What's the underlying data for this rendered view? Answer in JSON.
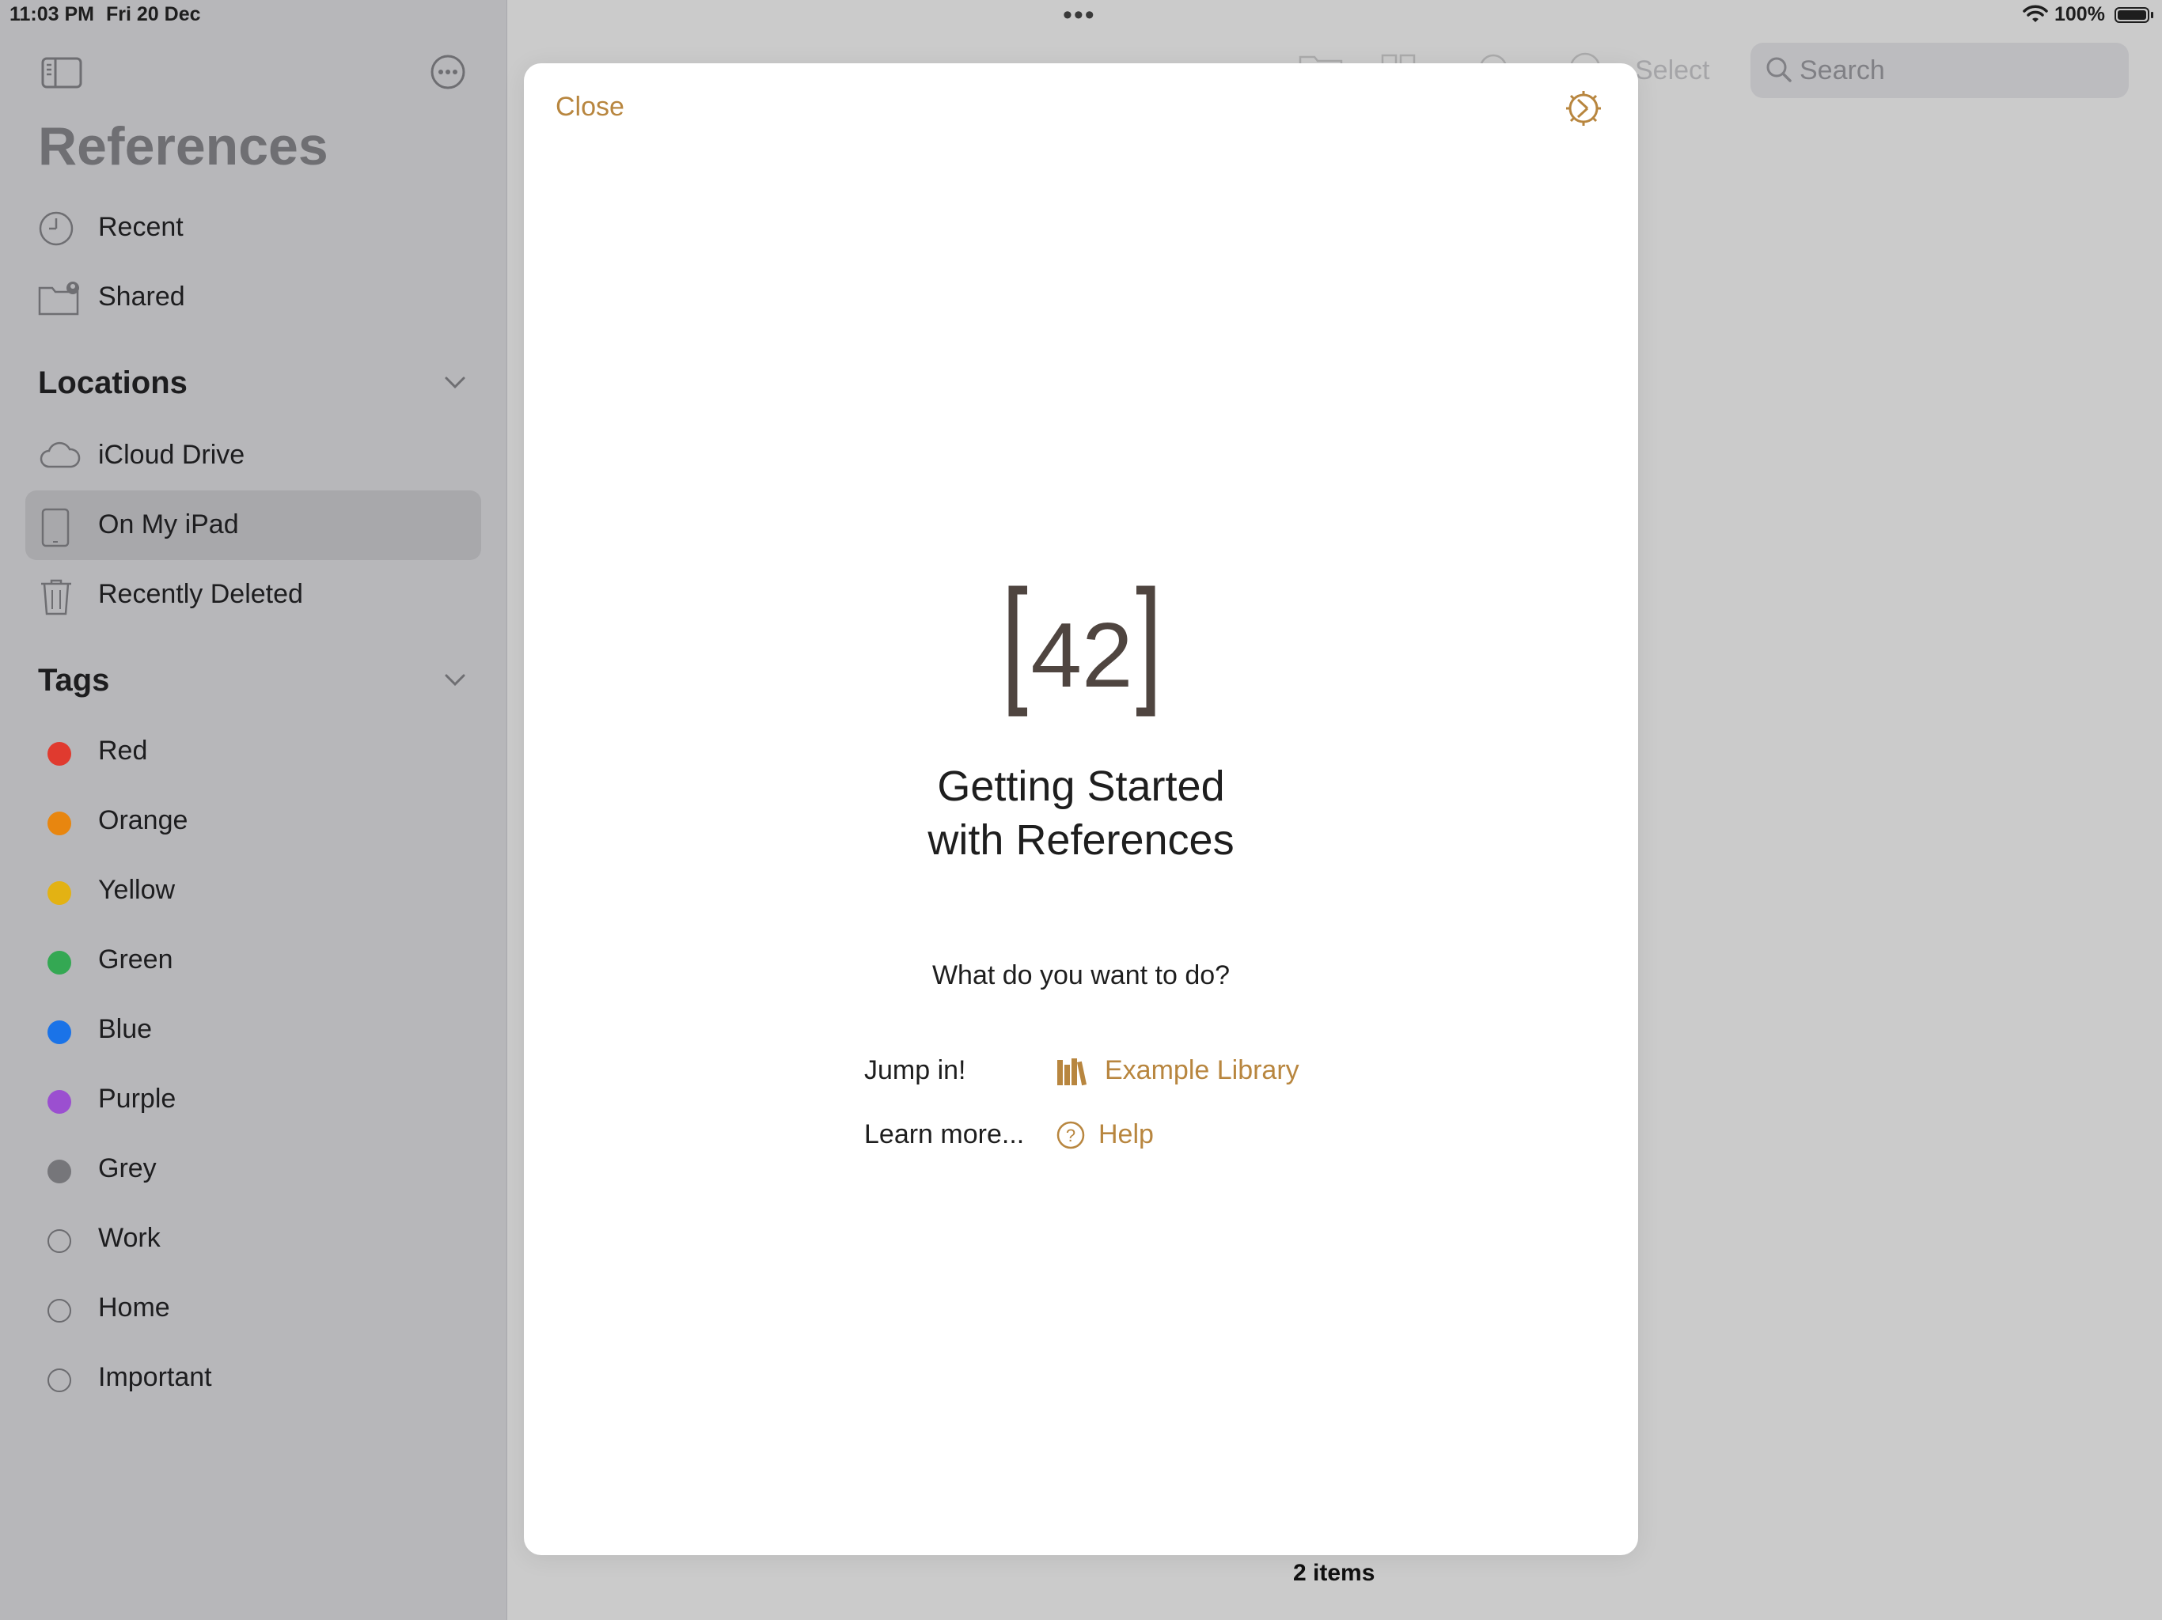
{
  "status_bar": {
    "time": "11:03 PM",
    "date": "Fri 20 Dec",
    "battery": "100%"
  },
  "sidebar": {
    "title": "References",
    "favorites": [
      {
        "label": "Recent",
        "icon": "clock-icon"
      },
      {
        "label": "Shared",
        "icon": "shared-folder-icon"
      }
    ],
    "locations_header": "Locations",
    "locations": [
      {
        "label": "iCloud Drive",
        "icon": "cloud-icon"
      },
      {
        "label": "On My iPad",
        "icon": "ipad-icon",
        "selected": true
      },
      {
        "label": "Recently Deleted",
        "icon": "trash-icon"
      }
    ],
    "tags_header": "Tags",
    "tags": [
      {
        "label": "Red",
        "color": "#e03a2f"
      },
      {
        "label": "Orange",
        "color": "#e8860f"
      },
      {
        "label": "Yellow",
        "color": "#e3b213"
      },
      {
        "label": "Green",
        "color": "#34a853"
      },
      {
        "label": "Blue",
        "color": "#1a73e8"
      },
      {
        "label": "Purple",
        "color": "#9b4fd0"
      },
      {
        "label": "Grey",
        "color": "#76767a"
      },
      {
        "label": "Work",
        "color": ""
      },
      {
        "label": "Home",
        "color": ""
      },
      {
        "label": "Important",
        "color": ""
      }
    ]
  },
  "toolbar": {
    "select_label": "Select",
    "search_placeholder": "Search"
  },
  "footer": {
    "item_count": "2 items"
  },
  "modal": {
    "close_label": "Close",
    "logo_text": "42",
    "heading_line1": "Getting Started",
    "heading_line2": "with References",
    "question": "What do you want to do?",
    "jump_label": "Jump in!",
    "example_link": "Example Library",
    "learn_label": "Learn more...",
    "help_link": "Help",
    "accent_color": "#b8863f"
  }
}
